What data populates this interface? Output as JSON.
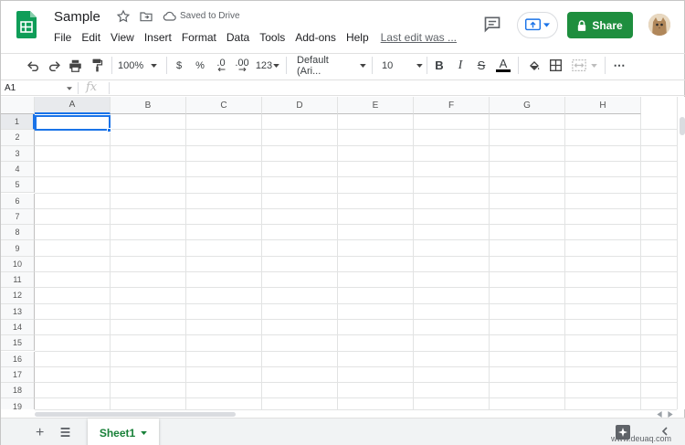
{
  "app": {
    "title": "Sample",
    "saved_status": "Saved to Drive",
    "share_label": "Share"
  },
  "menu": [
    "File",
    "Edit",
    "View",
    "Insert",
    "Format",
    "Data",
    "Tools",
    "Add-ons",
    "Help"
  ],
  "last_edit": "Last edit was ...",
  "toolbar": {
    "zoom": "100%",
    "currency": "$",
    "percent": "%",
    "decrease_decimals": ".0",
    "increase_decimals": ".00",
    "more_formats": "123",
    "font_family": "Default (Ari...",
    "font_size": "10",
    "bold": "B",
    "italic": "I",
    "strikethrough": "S",
    "text_color": "A",
    "more": "⋯"
  },
  "formula_bar": {
    "name_box": "A1",
    "fx": "fx",
    "value": ""
  },
  "grid": {
    "columns": [
      "A",
      "B",
      "C",
      "D",
      "E",
      "F",
      "G",
      "H"
    ],
    "rows": [
      "1",
      "2",
      "3",
      "4",
      "5",
      "6",
      "7",
      "8",
      "9",
      "10",
      "11",
      "12",
      "13",
      "14",
      "15",
      "16",
      "17",
      "18",
      "19"
    ],
    "selected_cell": "A1"
  },
  "sheets": [
    {
      "name": "Sheet1",
      "active": true
    }
  ],
  "watermark": "www.deuaq.com",
  "colors": {
    "accent_blue": "#1a73e8",
    "share_green": "#1e8e3e",
    "sheet_tab_green": "#188038",
    "logo_green": "#0f9d58"
  }
}
